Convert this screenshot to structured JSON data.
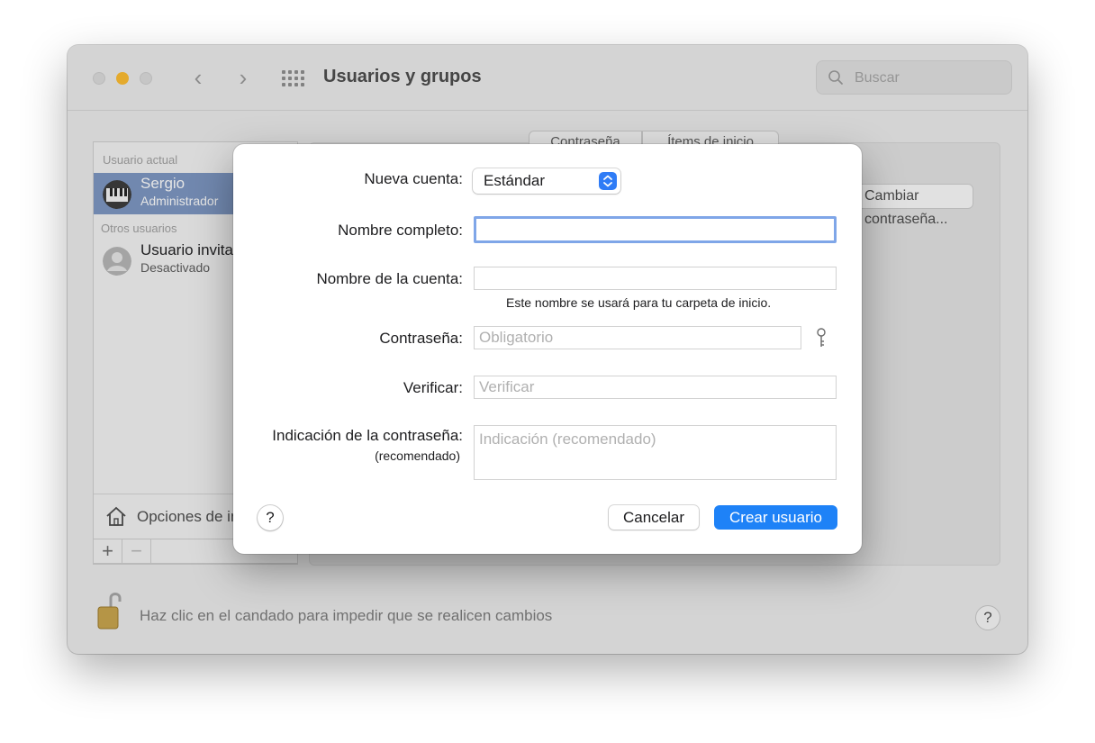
{
  "window": {
    "title": "Usuarios y grupos",
    "search_placeholder": "Buscar"
  },
  "sidebar": {
    "current_user_header": "Usuario actual",
    "current_user": {
      "name": "Sergio",
      "role": "Administrador"
    },
    "other_users_header": "Otros usuarios",
    "other_user": {
      "name": "Usuario invitado",
      "status": "Desactivado"
    },
    "login_options_label": "Opciones de inicio",
    "add_label": "+",
    "remove_label": "−"
  },
  "main": {
    "tabs": [
      "Contraseña",
      "Ítems de inicio"
    ],
    "change_password_label": "Cambiar contraseña..."
  },
  "footer": {
    "lock_message": "Haz clic en el candado para impedir que se realicen cambios",
    "help_label": "?"
  },
  "sheet": {
    "new_account_label": "Nueva cuenta:",
    "new_account_value": "Estándar",
    "full_name_label": "Nombre completo:",
    "full_name_value": "",
    "account_name_label": "Nombre de la cuenta:",
    "account_name_value": "",
    "account_name_hint": "Este nombre se usará para tu carpeta de inicio.",
    "password_label": "Contraseña:",
    "password_placeholder": "Obligatorio",
    "verify_label": "Verificar:",
    "verify_placeholder": "Verificar",
    "hint_label": "Indicación de la contraseña:",
    "hint_sublabel": "(recomendado)",
    "hint_placeholder": "Indicación (recomendado)",
    "help_label": "?",
    "cancel_label": "Cancelar",
    "create_label": "Crear usuario"
  },
  "colors": {
    "accent": "#1e82f7",
    "selection": "#7b96c2",
    "minimize": "#febc2e"
  },
  "icons": [
    "close-light",
    "minimize-light",
    "zoom-light",
    "back-chevron-icon",
    "forward-chevron-icon",
    "grid-icon",
    "search-icon",
    "piano-avatar-icon",
    "user-silhouette-icon",
    "house-icon",
    "lock-icon",
    "key-icon",
    "popup-arrows-icon"
  ]
}
